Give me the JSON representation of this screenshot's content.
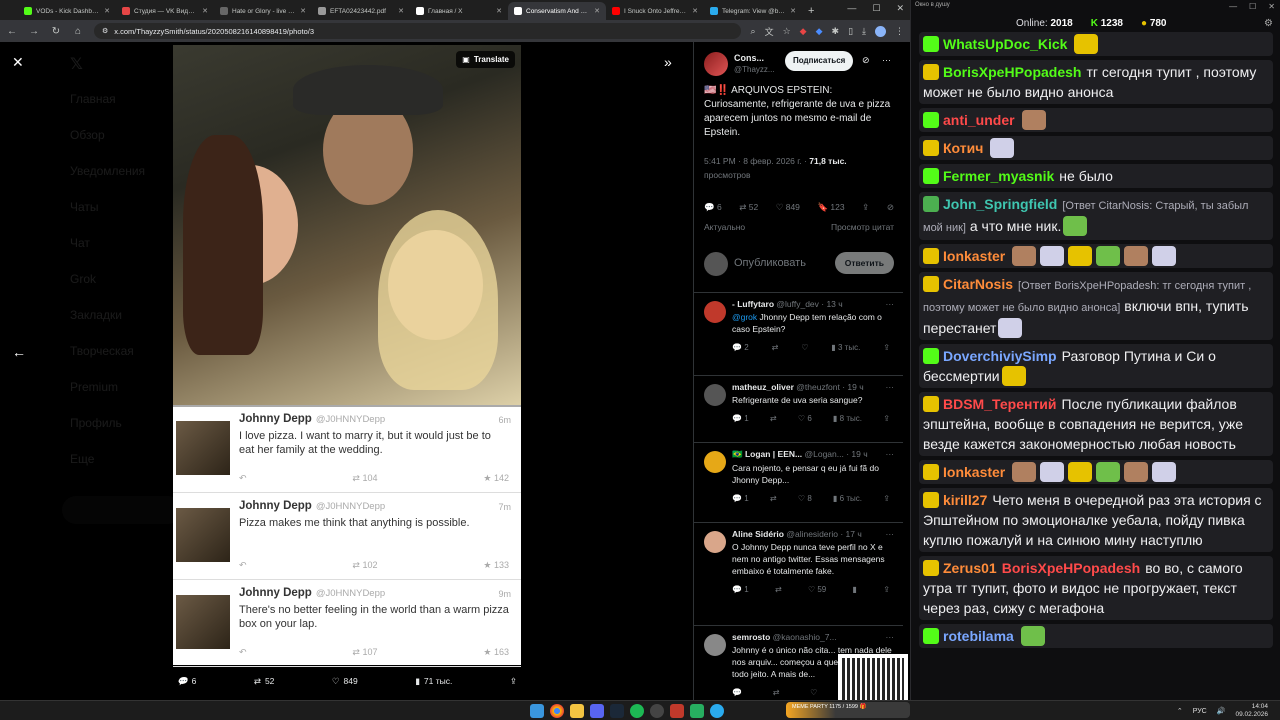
{
  "browser": {
    "tabs": [
      {
        "label": "VODs - Kick Dashboard",
        "color": "#53fc18"
      },
      {
        "label": "Студия — VK Видео Li...",
        "color": "#e64646"
      },
      {
        "label": "Hate or Glory - live • ...",
        "color": "#666"
      },
      {
        "label": "EFTA02423442.pdf",
        "color": "#999"
      },
      {
        "label": "Главная / X",
        "color": "#fff"
      },
      {
        "label": "Conservatism And Ele...",
        "color": "#fff"
      },
      {
        "label": "I Snuck Onto Jeffrey E...",
        "color": "#ff0000"
      },
      {
        "label": "Telegram: View @bloo...",
        "color": "#2aabee"
      }
    ],
    "new_tab": "+",
    "url": "x.com/ThayzzySmith/status/2020508216140898419/photo/3"
  },
  "bg_nav": [
    "Главная",
    "Обзор",
    "Уведомления",
    "Чаты",
    "Чат",
    "Grok",
    "Закладки",
    "Творческая",
    "Premium",
    "Профиль",
    "Еще"
  ],
  "media": {
    "translate": "Translate",
    "image_tweets": [
      {
        "name": "Johnny Depp",
        "handle": "@J0HNNYDepp",
        "time": "6m",
        "text": "I love pizza. I want to marry it, but it would just be to eat her family at the wedding.",
        "retweets": "104",
        "favs": "142"
      },
      {
        "name": "Johnny Depp",
        "handle": "@J0HNNYDepp",
        "time": "7m",
        "text": "Pizza makes me think that anything is possible.",
        "retweets": "102",
        "favs": "133"
      },
      {
        "name": "Johnny Depp",
        "handle": "@J0HNNYDepp",
        "time": "9m",
        "text": "There's no better feeling in the world than a warm pizza box on your lap.",
        "retweets": "107",
        "favs": "163"
      }
    ],
    "actions": {
      "replies": "6",
      "reposts": "52",
      "likes": "849",
      "views": "71 тыс."
    }
  },
  "thread": {
    "author_name": "Cons...",
    "author_handle": "@Thayzz...",
    "follow_label": "Подписаться",
    "text": "🇺🇸‼️ ARQUIVOS EPSTEIN: Curiosamente, refrigerante de uva e pizza aparecem juntos no mesmo e-mail de Epstein.",
    "time": "5:41 PM · 8 февр. 2026 г. ·",
    "views": "71,8 тыс.",
    "views_label": "просмотров",
    "stats": {
      "replies": "6",
      "reposts": "52",
      "likes": "849",
      "bookmarks": "123"
    },
    "sort_label": "Актуально",
    "quotes_label": "Просмотр цитат",
    "compose_placeholder": "Опубликовать",
    "compose_button": "Ответить",
    "replies": [
      {
        "name": "- Luffytaro",
        "handle": "@luffy_dev · 13 ч",
        "mention": "@grok",
        "text": " Jhonny Depp tem relação com o caso Epstein?",
        "r": "2",
        "rt": "",
        "l": "",
        "v": "3 тыс.",
        "color": "#c0392b"
      },
      {
        "name": "matheuz_oliver",
        "handle": "@theuzfont · 19 ч",
        "mention": "",
        "text": "Refrigerante de uva seria sangue?",
        "r": "1",
        "rt": "",
        "l": "6",
        "v": "8 тыс.",
        "color": "#555"
      },
      {
        "name": "🇧🇷 Logan | EEN...",
        "handle": "@Logan... · 19 ч",
        "mention": "",
        "text": "Cara nojento, e pensar q eu já fui fã do Jhonny Depp...",
        "r": "1",
        "rt": "",
        "l": "8",
        "v": "6 тыс.",
        "color": "#e6a817"
      },
      {
        "name": "Aline Sidério",
        "handle": "@alinesiderio · 17 ч",
        "mention": "",
        "text": "O Johnny Depp nunca teve perfil no X e nem no antigo twitter. Essas mensagens embaixo é totalmente fake.",
        "r": "1",
        "rt": "",
        "l": "59",
        "v": "",
        "color": "#d9a68a"
      },
      {
        "name": "semrosto",
        "handle": "@kaonashio_7...",
        "mention": "",
        "text": "Johnny é o único não cita... tem nada dele nos arquiv... começou a querer enfiar... todo jeito. A mais de...",
        "r": "",
        "rt": "",
        "l": "",
        "v": "",
        "color": "#888"
      }
    ]
  },
  "chat": {
    "window_title": "Окно в душу",
    "online_label": "Online:",
    "online": "2018",
    "kick_count": "1238",
    "other_count": "780",
    "messages": [
      {
        "user": "WhatsUpDoc_Kick",
        "color": "#53fc18",
        "badge": "#53fc18",
        "text": "",
        "reply": ""
      },
      {
        "user": "BorisXpeHPopadesh",
        "color": "#53fc18",
        "badge": "#e6c200",
        "text": "тг сегодня тупит , поэтому может не было видно анонса",
        "reply": ""
      },
      {
        "user": "anti_under",
        "color": "#ff4a4a",
        "badge": "#53fc18",
        "text": "",
        "reply": ""
      },
      {
        "user": "Котич",
        "color": "#ff8c3a",
        "badge": "#e6c200",
        "text": "",
        "reply": ""
      },
      {
        "user": "Fermer_myasnik",
        "color": "#53fc18",
        "badge": "#53fc18",
        "text": "не было",
        "reply": ""
      },
      {
        "user": "John_Springfield",
        "color": "#3fc6b0",
        "badge": "#4caf50",
        "text": "а что мне ник.",
        "reply": "[Ответ CitarNosis: Старый, ты забыл мой ник]"
      },
      {
        "user": "Ionkaster",
        "color": "#ff8c3a",
        "badge": "#e6c200",
        "text": "",
        "reply": ""
      },
      {
        "user": "CitarNosis",
        "color": "#ff8c3a",
        "badge": "#e6c200",
        "text": "включи впн, тупить перестанет",
        "reply": "[Ответ BorisXpeHPopadesh: тг сегодня тупит , поэтому может не было видно анонса]"
      },
      {
        "user": "DoverchiviySimp",
        "color": "#7aa7ff",
        "badge": "#53fc18",
        "text": "Разговор Путина и Си о бессмертии",
        "reply": ""
      },
      {
        "user": "BDSM_Терентий",
        "color": "#ff4a4a",
        "badge": "#e6c200",
        "text": "После публикации файлов эпштейна, вообще в совпадения не верится, уже везде кажется закономерностью любая новость",
        "reply": ""
      },
      {
        "user": "Ionkaster",
        "color": "#ff8c3a",
        "badge": "#e6c200",
        "text": "",
        "reply": ""
      },
      {
        "user": "kirill27",
        "color": "#ff8c3a",
        "badge": "#e6c200",
        "text": "Чето меня в очередной раз эта история с Эпштейном по эмоционалке уебала, пойду пивка куплю пожалуй и на синюю мину наступлю",
        "reply": ""
      },
      {
        "user": "Zerus01",
        "color": "#ff8c3a",
        "badge": "#e6c200",
        "text": "во во, с самого утра тг тупит, фото и видос не прогружает, текст через раз, сижу с мегафона",
        "reply": "",
        "mention": "BorisXpeHPopadesh"
      },
      {
        "user": "rotebilama",
        "color": "#7aa7ff",
        "badge": "#53fc18",
        "text": "",
        "reply": ""
      }
    ]
  },
  "taskbar": {
    "promo": "MEME PARTY    1175 / 1599 🎁",
    "lang": "РУС",
    "time": "14:04",
    "date": "09.02.2026"
  }
}
